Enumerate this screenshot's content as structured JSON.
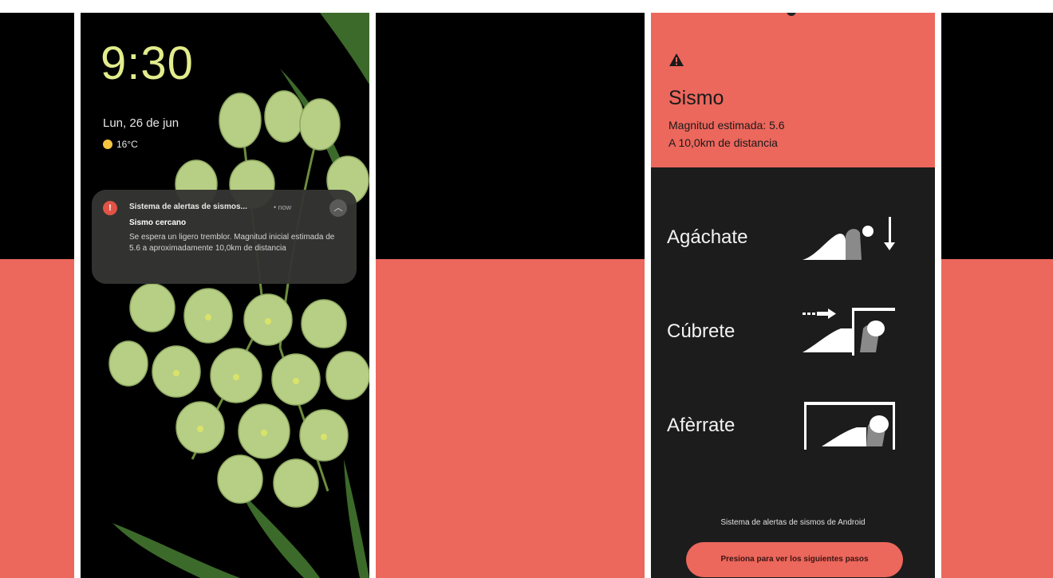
{
  "lockscreen": {
    "time": "9:30",
    "date": "Lun, 26 de jun",
    "weather": {
      "icon": "sun-icon",
      "temperature": "16°C"
    },
    "notification": {
      "app_name": "Sistema de alertas de sismos...",
      "time": "• now",
      "title": "Sismo cercano",
      "body": "Se espera un ligero tremblor. Magnitud inicial estimada de 5.6 a aproximadamente 10,0km de distancia",
      "icon": "warning-icon"
    }
  },
  "alert_screen": {
    "title": "Sismo",
    "magnitude": "Magnitud estimada: 5.6",
    "distance": "A 10,0km de distancia",
    "steps": [
      {
        "label": "Agáchate",
        "icon": "drop-illustration"
      },
      {
        "label": "Cúbrete",
        "icon": "cover-illustration"
      },
      {
        "label": "Afèrrate",
        "icon": "hold-on-illustration"
      }
    ],
    "footer": "Sistema de alertas de sismos de Android",
    "cta_label": "Presiona para ver los siguientes pasos"
  },
  "colors": {
    "alert_red": "#ec675c",
    "dark_bg": "#1c1c1c",
    "clock_yellow": "#e2ec8c"
  }
}
